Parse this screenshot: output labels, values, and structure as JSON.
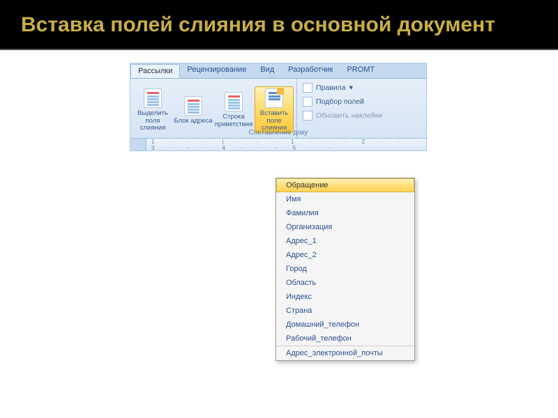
{
  "slide": {
    "title": "Вставка полей слияния в основной документ"
  },
  "tabs": {
    "items": [
      {
        "label": "Рассылки",
        "active": true
      },
      {
        "label": "Рецензирование"
      },
      {
        "label": "Вид"
      },
      {
        "label": "Разработчик"
      },
      {
        "label": "PROMT"
      }
    ]
  },
  "ribbon": {
    "group_label": "Составление доку",
    "buttons": [
      {
        "label": "Выделить поля слияния"
      },
      {
        "label": "Блок адреса"
      },
      {
        "label": "Строка приветствия"
      },
      {
        "label": "Вставить поле слияния",
        "active": true
      }
    ],
    "side": [
      {
        "label": "Правила"
      },
      {
        "label": "Подбор полей"
      },
      {
        "label": "Обновить наклейки"
      }
    ]
  },
  "ruler": {
    "marks": "1 · · · | · · · 1 · · · 2 · · · 3 · · · 4 · · · 5 · ·"
  },
  "dropdown": {
    "items": [
      {
        "label": "Обращение",
        "selected": true
      },
      {
        "label": "Имя"
      },
      {
        "label": "Фамилия"
      },
      {
        "label": "Организация"
      },
      {
        "label": "Адрес_1"
      },
      {
        "label": "Адрес_2"
      },
      {
        "label": "Город"
      },
      {
        "label": "Область"
      },
      {
        "label": "Индекс"
      },
      {
        "label": "Страна"
      },
      {
        "label": "Домашний_телефон"
      },
      {
        "label": "Рабочий_телефон"
      },
      {
        "label": "Адрес_электронной_почты"
      }
    ]
  }
}
